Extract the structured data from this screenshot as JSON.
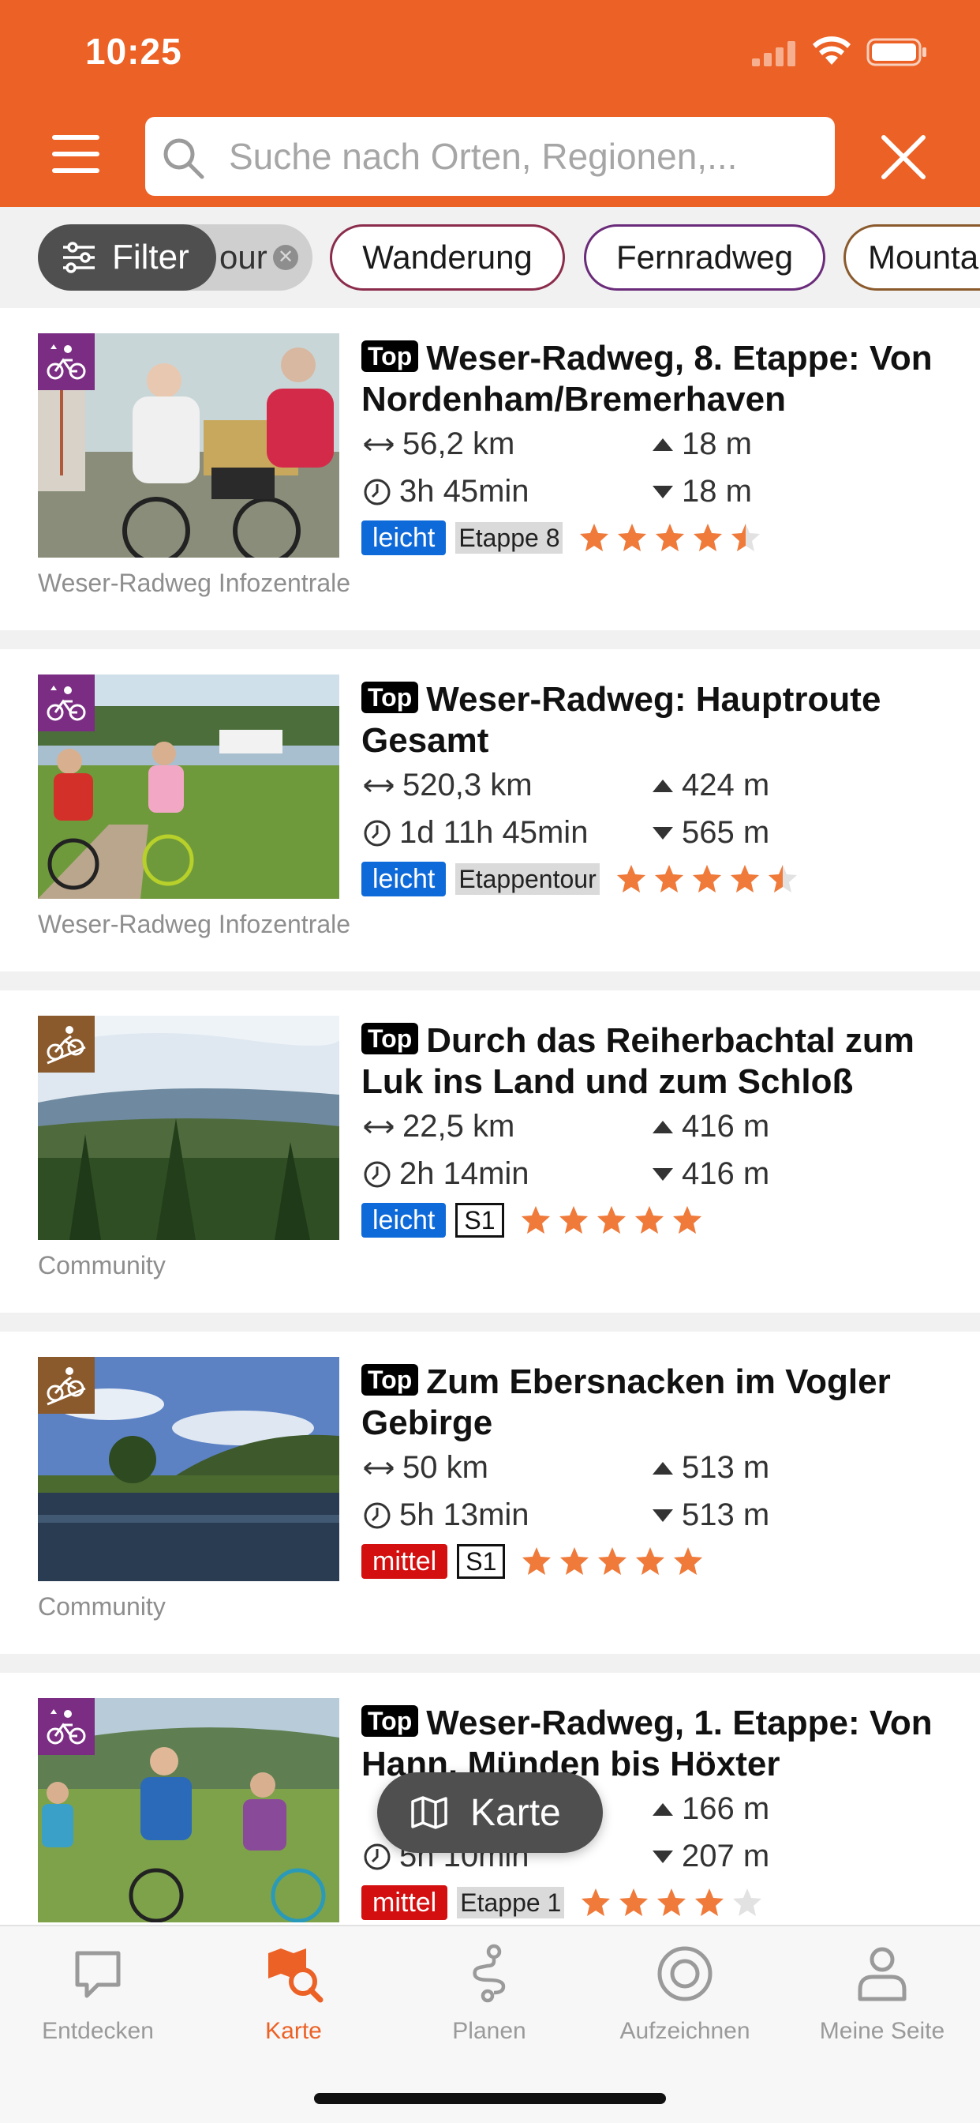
{
  "status_bar": {
    "time": "10:25"
  },
  "search": {
    "placeholder": "Suche nach Orten, Regionen,..."
  },
  "filters": {
    "filter_label": "Filter",
    "chips": [
      "Etappentour",
      "Wanderung",
      "Fernradweg",
      "Mountainbike"
    ],
    "chip_visible_text": {
      "tour": "our",
      "mountain": "Mounta"
    }
  },
  "tours": [
    {
      "title": "Weser-Radweg, 8. Etappe: Von Nordenham/Bremerhaven",
      "top_label": "Top",
      "distance": "56,2 km",
      "duration": "3h 45min",
      "ascent": "18 m",
      "descent": "18 m",
      "difficulty": "leicht",
      "tag": "Etappe 8",
      "rating": 4.5,
      "source": "Weser-Radweg Infozentrale",
      "category_icon": "bike-touring-icon",
      "category_color": "#7b2d83"
    },
    {
      "title": "Weser-Radweg: Hauptroute Gesamt",
      "top_label": "Top",
      "distance": "520,3 km",
      "duration": "1d 11h 45min",
      "ascent": "424 m",
      "descent": "565 m",
      "difficulty": "leicht",
      "tag": "Etappentour",
      "rating": 4.5,
      "source": "Weser-Radweg Infozentrale",
      "category_icon": "bike-touring-icon",
      "category_color": "#7b2d83"
    },
    {
      "title": "Durch das Reiherbachtal zum Luk ins Land und zum Schloß",
      "top_label": "Top",
      "distance": "22,5 km",
      "duration": "2h 14min",
      "ascent": "416 m",
      "descent": "416 m",
      "difficulty": "leicht",
      "tag": "S1",
      "rating": 5,
      "source": "Community",
      "category_icon": "mountainbike-icon",
      "category_color": "#8a5a2c"
    },
    {
      "title": "Zum Ebersnacken im Vogler Gebirge",
      "top_label": "Top",
      "distance": "50 km",
      "duration": "5h 13min",
      "ascent": "513 m",
      "descent": "513 m",
      "difficulty": "mittel",
      "tag": "S1",
      "rating": 5,
      "source": "Community",
      "category_icon": "mountainbike-icon",
      "category_color": "#8a5a2c"
    },
    {
      "title": "Weser-Radweg, 1. Etappe: Von Hann. Münden bis Höxter",
      "top_label": "Top",
      "distance": "",
      "duration": "5h 10min",
      "ascent": "166 m",
      "descent": "207 m",
      "difficulty": "mittel",
      "tag": "Etappe 1",
      "rating": 4,
      "source": "",
      "category_icon": "bike-touring-icon",
      "category_color": "#7b2d83"
    }
  ],
  "map_button": {
    "label": "Karte"
  },
  "bottom_nav": [
    {
      "label": "Entdecken",
      "icon": "chat-bubble-icon",
      "active": false
    },
    {
      "label": "Karte",
      "icon": "map-search-icon",
      "active": true
    },
    {
      "label": "Planen",
      "icon": "route-icon",
      "active": false
    },
    {
      "label": "Aufzeichnen",
      "icon": "record-icon",
      "active": false
    },
    {
      "label": "Meine Seite",
      "icon": "person-icon",
      "active": false
    }
  ],
  "colors": {
    "brand_orange": "#ec6125",
    "star_orange": "#f07a3a",
    "difficulty_easy": "#0e6ad9",
    "difficulty_medium": "#d40f0f",
    "fab_grey": "#4f4f4f"
  }
}
